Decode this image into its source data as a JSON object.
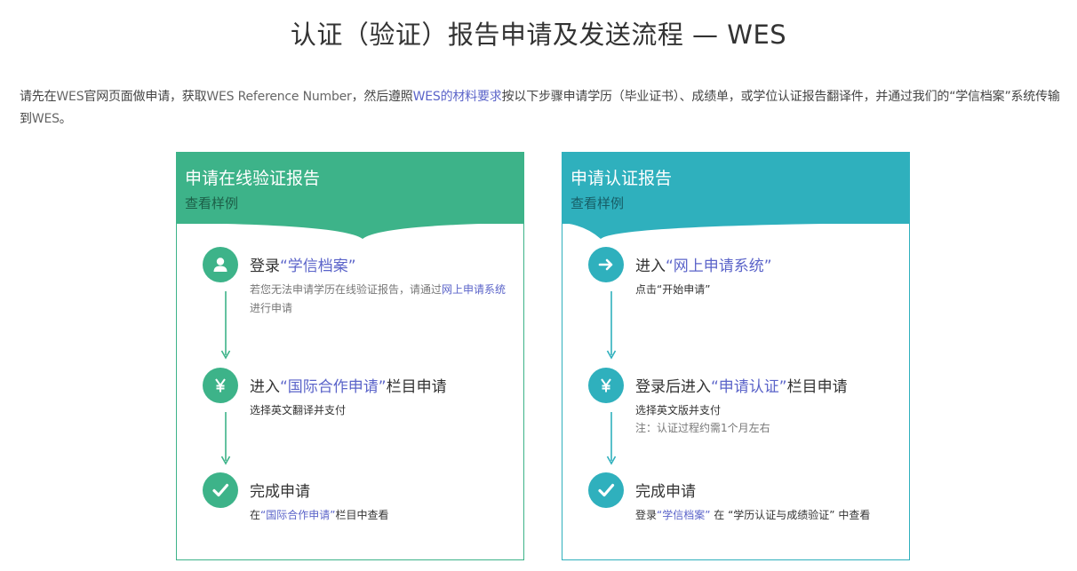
{
  "page_title": "认证（验证）报告申请及发送流程 — WES",
  "intro": {
    "t1": "请先在",
    "wes1": "WES",
    "t2": "官网页面做申请，获取",
    "wes2": "WES Reference Number",
    "t3": "，然后遵照",
    "link": "WES的材料要求",
    "t4": "按以下步骤申请学历（毕业证书）、成绩单，或学位认证报告翻译件，并通过我们的“学信档案”系统传输到",
    "wes3": "WES",
    "t5": "。"
  },
  "colors": {
    "green": "#3db389",
    "teal": "#2fb0bd",
    "link": "#5b64c9"
  },
  "cards": [
    {
      "title": "申请在线验证报告",
      "subtitle": "查看样例",
      "steps": [
        {
          "icon": "user-icon",
          "title_prefix": "登录",
          "title_link": "“学信档案”",
          "title_suffix": "",
          "desc_prefix": "若您无法申请学历在线验证报告，请通过",
          "desc_link": "网上申请系统",
          "desc_suffix": "进行申请"
        },
        {
          "icon": "yen-icon",
          "title_prefix": "进入",
          "title_link": "“国际合作申请”",
          "title_suffix": "栏目申请",
          "desc": "选择英文翻译并支付"
        },
        {
          "icon": "check-icon",
          "title": "完成申请",
          "desc_prefix": "在",
          "desc_link": "“国际合作申请”",
          "desc_suffix": "栏目中查看"
        }
      ]
    },
    {
      "title": "申请认证报告",
      "subtitle": "查看样例",
      "steps": [
        {
          "icon": "arrow-right-icon",
          "title_prefix": "进入",
          "title_link": "“网上申请系统”",
          "title_suffix": "",
          "desc": "点击“开始申请”"
        },
        {
          "icon": "yen-icon",
          "title_prefix": "登录后进入",
          "title_link": "“申请认证”",
          "title_suffix": "栏目申请",
          "desc": "选择英文版并支付",
          "note": "注：认证过程约需1个月左右"
        },
        {
          "icon": "check-icon",
          "title": "完成申请",
          "desc_prefix": "登录",
          "desc_link": "“学信档案”",
          "desc_suffix": " 在 “学历认证与成绩验证” 中查看"
        }
      ]
    }
  ]
}
